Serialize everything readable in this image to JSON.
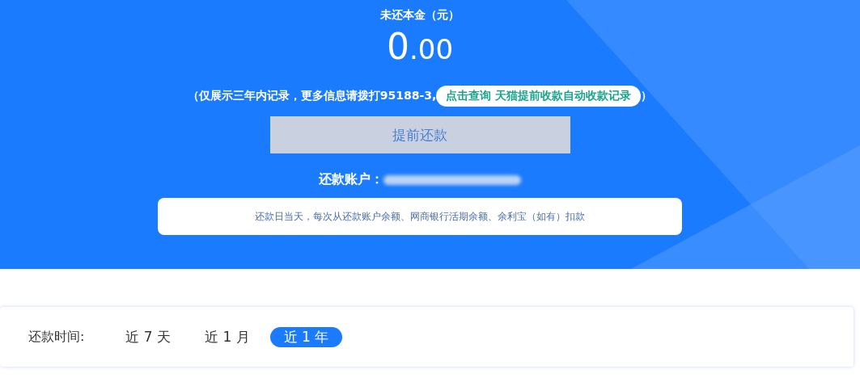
{
  "summary": {
    "title": "未还本金（元）",
    "amount_integer": "0",
    "amount_decimal": ".00",
    "notice_before": "（仅展示三年内记录，更多信息请拨打95188-3,",
    "notice_link": "点击查询 天猫提前收款自动收款记录",
    "notice_after": "）",
    "prepay_button": {
      "label": "提前还款",
      "disabled": true
    },
    "account_label": "还款账户：",
    "tooltip": "还款日当天，每次从还款账户余额、网商银行活期余额、余利宝（如有）扣款"
  },
  "filter": {
    "label": "还款时间:",
    "options": [
      {
        "label": "近 7 天",
        "selected": false
      },
      {
        "label": "近 1 月",
        "selected": false
      },
      {
        "label": "近 1 年",
        "selected": true
      }
    ]
  }
}
